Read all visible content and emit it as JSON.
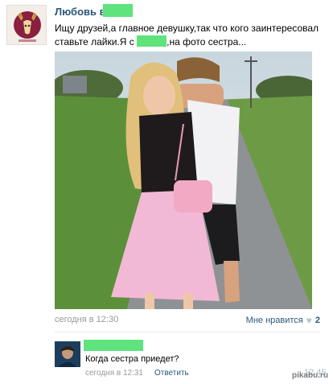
{
  "post": {
    "author": "Любовь в",
    "text_line1": "Ищу друзей,а главное девушку,так что кого заинтересовал",
    "text_line2_prefix": "ставьте лайки.Я с",
    "text_line2_suffix": ",на фото сестра...",
    "time": "сегодня в 12:30",
    "like_label": "Мне нравится",
    "like_count": "2",
    "like_icon": "heart-icon"
  },
  "comment": {
    "text": "Когда сестра приедет?",
    "time": "сегодня в 12:31",
    "reply_label": "Ответить",
    "counter": "12.45"
  },
  "watermark": "pikabu.ru",
  "colors": {
    "link": "#2b587a",
    "mask": "#5fe37d",
    "muted": "#999999"
  }
}
